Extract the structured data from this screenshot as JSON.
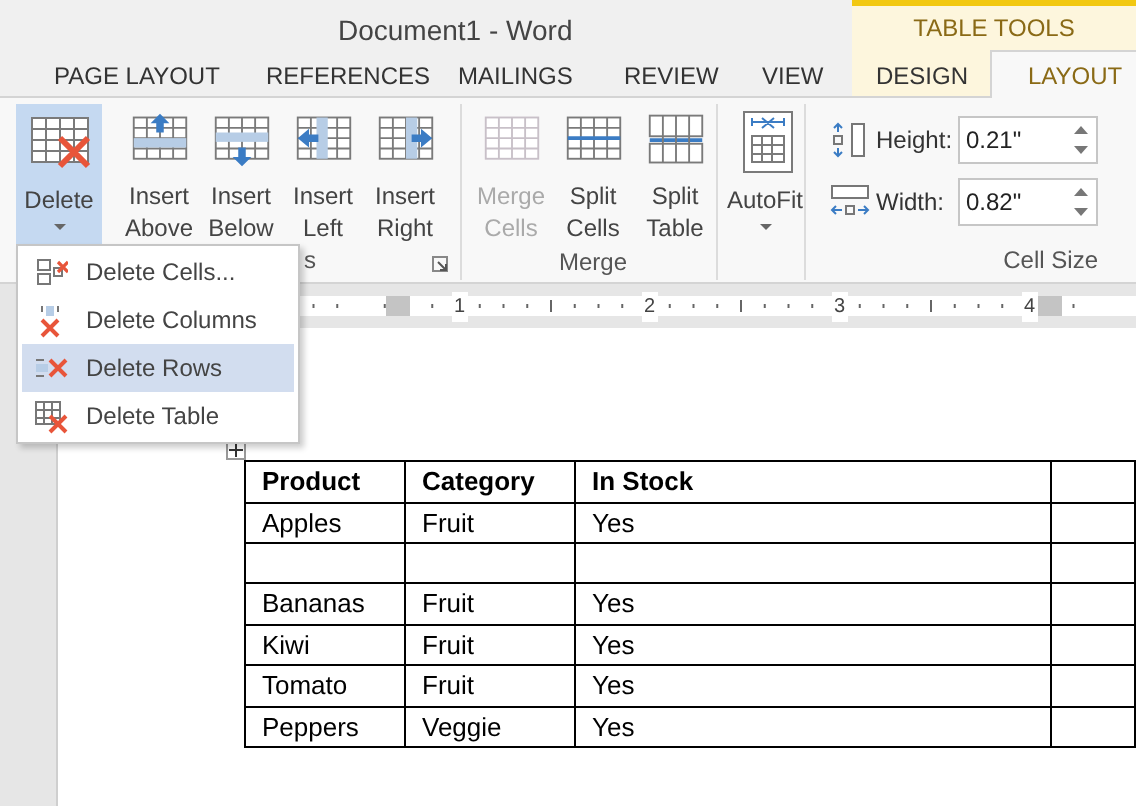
{
  "window": {
    "title": "Document1 - Word"
  },
  "tabs": [
    {
      "label": "PAGE LAYOUT",
      "selected": false
    },
    {
      "label": "REFERENCES",
      "selected": false
    },
    {
      "label": "MAILINGS",
      "selected": false
    },
    {
      "label": "REVIEW",
      "selected": false
    },
    {
      "label": "VIEW",
      "selected": false
    }
  ],
  "table_tools": {
    "label": "TABLE TOOLS",
    "tabs": [
      {
        "label": "DESIGN",
        "selected": false
      },
      {
        "label": "LAYOUT",
        "selected": true
      }
    ]
  },
  "ribbon_groups": [
    {
      "label": "s",
      "launcher": true,
      "buttons": [
        {
          "kind": "split",
          "lines": [
            "Delete"
          ],
          "pressed": true,
          "disabled": false
        },
        {
          "kind": "plain",
          "lines": [
            "Insert",
            "Above"
          ],
          "pressed": false,
          "disabled": false
        },
        {
          "kind": "plain",
          "lines": [
            "Insert",
            "Below"
          ],
          "pressed": false,
          "disabled": false
        },
        {
          "kind": "plain",
          "lines": [
            "Insert",
            "Left"
          ],
          "pressed": false,
          "disabled": false
        },
        {
          "kind": "plain",
          "lines": [
            "Insert",
            "Right"
          ],
          "pressed": false,
          "disabled": false
        }
      ]
    },
    {
      "label": "Merge",
      "buttons": [
        {
          "kind": "plain",
          "lines": [
            "Merge",
            "Cells"
          ],
          "pressed": false,
          "disabled": true
        },
        {
          "kind": "plain",
          "lines": [
            "Split",
            "Cells"
          ],
          "pressed": false,
          "disabled": false
        },
        {
          "kind": "plain",
          "lines": [
            "Split",
            "Table"
          ],
          "pressed": false,
          "disabled": false
        }
      ]
    },
    {
      "buttons": [
        {
          "kind": "split",
          "lines": [
            "AutoFit"
          ],
          "pressed": false,
          "disabled": false
        }
      ]
    }
  ],
  "cell_size": {
    "label": "Cell Size",
    "fields": [
      {
        "label": "Height:",
        "value": "0.21\""
      },
      {
        "label": "Width:",
        "value": "0.82\""
      }
    ]
  },
  "delete_menu": [
    {
      "label": "Delete Cells...",
      "selected": false
    },
    {
      "label": "Delete Columns",
      "selected": false
    },
    {
      "label": "Delete Rows",
      "selected": true
    },
    {
      "label": "Delete Table",
      "selected": false
    }
  ],
  "ruler": {
    "numbers": [
      "1",
      "2",
      "3",
      "4"
    ]
  },
  "table": {
    "columns": [
      "Product",
      "Category",
      "In Stock"
    ],
    "rows": [
      {
        "cells": [
          "Apples",
          "Fruit",
          "Yes"
        ]
      },
      {
        "cells": []
      },
      {
        "cells": [
          "Bananas",
          "Fruit",
          "Yes"
        ]
      },
      {
        "cells": [
          "Kiwi",
          "Fruit",
          "Yes"
        ]
      },
      {
        "cells": [
          "Tomato",
          "Fruit",
          "Yes"
        ]
      },
      {
        "cells": [
          "Peppers",
          "Veggie",
          "Yes"
        ]
      }
    ]
  }
}
